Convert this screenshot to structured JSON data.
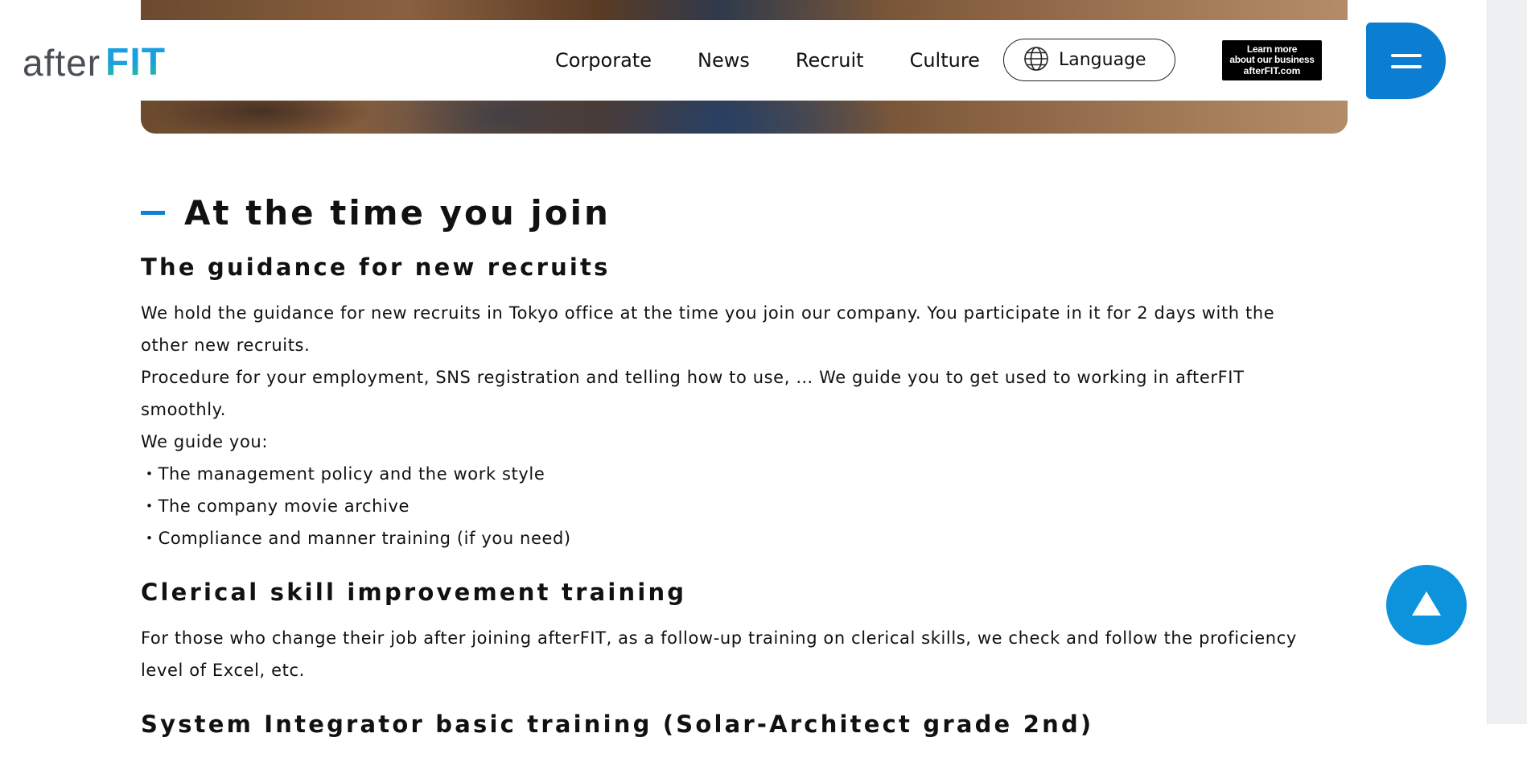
{
  "header": {
    "logo_after": "after",
    "logo_fit": "FIT",
    "nav": [
      "Corporate",
      "News",
      "Recruit",
      "Culture"
    ],
    "language_label": "Language",
    "business_banner": {
      "line1": "Learn more",
      "line2": "about our business",
      "line3": "afterFIT.com"
    }
  },
  "icons": {
    "language": "globe-icon",
    "menu": "hamburger-menu-icon",
    "to_top": "triangle-up-icon"
  },
  "colors": {
    "accent": "#0b7ed1",
    "to_top": "#0d92dc"
  },
  "main": {
    "section_title": "At the time you join",
    "blocks": [
      {
        "heading": "The guidance for new recruits",
        "lines": [
          "We hold the guidance for new recruits in Tokyo office at the time you join our company. You participate in it for 2 days with the other new recruits.",
          "Procedure for your employment, SNS registration and telling how to use, … We guide you to get used to working in afterFIT smoothly.",
          "We guide you:",
          "・The management policy and the work style",
          "・The company movie archive",
          "・Compliance and manner training (if you need)"
        ]
      },
      {
        "heading": "Clerical skill improvement training",
        "lines": [
          "For those who change their job after joining afterFIT, as a follow-up training on clerical skills, we check and follow the proficiency level of Excel, etc."
        ]
      },
      {
        "heading": "System Integrator basic training (Solar-Architect grade 2nd)",
        "lines": []
      }
    ]
  }
}
